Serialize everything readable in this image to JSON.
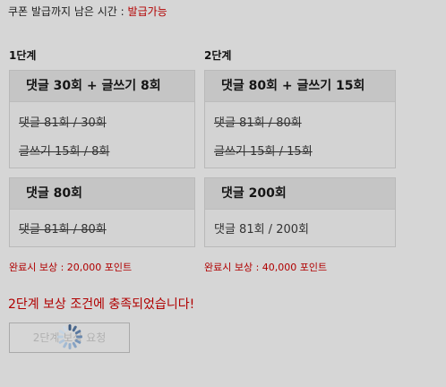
{
  "top": {
    "label": "쿠폰 발급까지 남은 시간 : ",
    "status": "발급가능"
  },
  "stages": [
    {
      "label": "1단계"
    },
    {
      "label": "2단계"
    }
  ],
  "boxes": [
    {
      "title": "댓글 30회 + 글쓰기 8회",
      "rows": [
        "댓글 81회 / 30회",
        "글쓰기 15회 / 8회"
      ]
    },
    {
      "title": "댓글 80회 + 글쓰기 15회",
      "rows": [
        "댓글 81회 / 80회",
        "글쓰기 15회 / 15회"
      ]
    },
    {
      "title": "댓글 80회",
      "rows": [
        "댓글 81회 / 80회"
      ]
    },
    {
      "title": "댓글 200회",
      "rows": [
        "댓글 81회 / 200회"
      ]
    }
  ],
  "rewards": [
    "완료시 보상 : 20,000 포인트",
    "완료시 보상 : 40,000 포인트"
  ],
  "notice": "2단계 보상 조건에 충족되었습니다!",
  "request_button": {
    "label": "2단계 보상 요청"
  },
  "colors": {
    "accent_red": "#b00000",
    "background": "#d6d6d6"
  }
}
